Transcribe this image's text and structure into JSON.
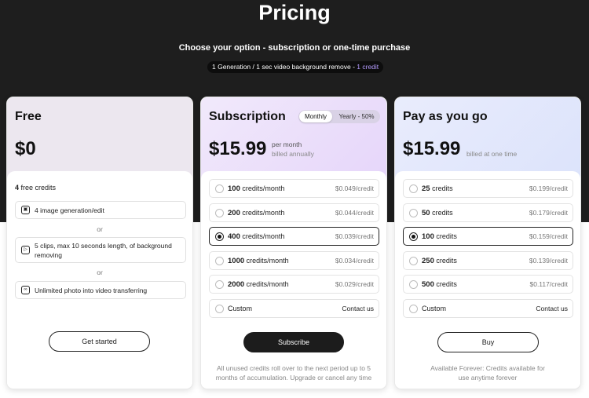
{
  "hero": {
    "title": "Pricing",
    "subtitle": "Choose your option - subscription or one-time purchase",
    "pill_text": "1 Generation / 1 sec video background remove - ",
    "pill_accent": "1 credit"
  },
  "free": {
    "title": "Free",
    "price": "$0",
    "credits_count": "4",
    "credits_text": "free credits",
    "features": [
      {
        "text": "4 image generation/edit",
        "icon": "image-icon"
      },
      {
        "text": "5 clips, max 10 seconds length, of background removing",
        "icon": "play-icon"
      },
      {
        "text": "Unlimited photo into video transferring",
        "icon": "infinity-icon"
      }
    ],
    "or_label": "or",
    "button": "Get started"
  },
  "subscription": {
    "title": "Subscription",
    "price": "$15.99",
    "price_note_1": "per month",
    "price_note_2": "billed annually",
    "toggle": {
      "monthly": "Monthly",
      "yearly": "Yearly - 50%",
      "selected": "Monthly"
    },
    "options": [
      {
        "amount": "100",
        "unit": "credits/month",
        "price": "$0.049/credit",
        "selected": false
      },
      {
        "amount": "200",
        "unit": "credits/month",
        "price": "$0.044/credit",
        "selected": false
      },
      {
        "amount": "400",
        "unit": "credits/month",
        "price": "$0.039/credit",
        "selected": true
      },
      {
        "amount": "1000",
        "unit": "credits/month",
        "price": "$0.034/credit",
        "selected": false
      },
      {
        "amount": "2000",
        "unit": "credits/month",
        "price": "$0.029/credit",
        "selected": false
      }
    ],
    "custom": {
      "label": "Custom",
      "action": "Contact us"
    },
    "button": "Subscribe",
    "footnote": "All unused credits roll over to the next period up to 5 months of accumulation. Upgrade or cancel any time"
  },
  "payg": {
    "title": "Pay as you go",
    "price": "$15.99",
    "price_note": "billed at one time",
    "options": [
      {
        "amount": "25",
        "unit": "credits",
        "price": "$0.199/credit",
        "selected": false
      },
      {
        "amount": "50",
        "unit": "credits",
        "price": "$0.179/credit",
        "selected": false
      },
      {
        "amount": "100",
        "unit": "credits",
        "price": "$0.159/credit",
        "selected": true
      },
      {
        "amount": "250",
        "unit": "credits",
        "price": "$0.139/credit",
        "selected": false
      },
      {
        "amount": "500",
        "unit": "credits",
        "price": "$0.117/credit",
        "selected": false
      }
    ],
    "custom": {
      "label": "Custom",
      "action": "Contact us"
    },
    "button": "Buy",
    "footnote": "Available Forever: Credits available for use anytime forever"
  },
  "colors": {
    "hero_bg": "#1e1e1e",
    "accent": "#b59cff",
    "button_dark": "#1c1c1c"
  }
}
